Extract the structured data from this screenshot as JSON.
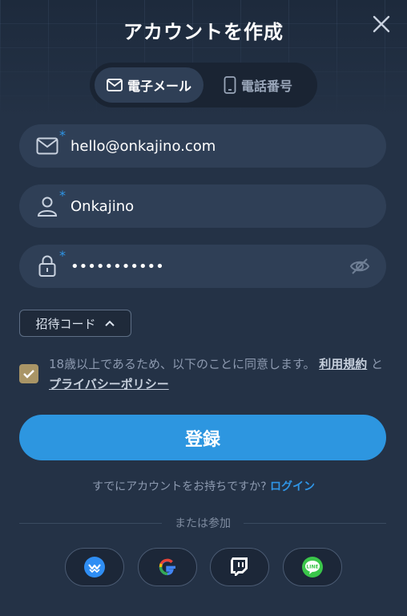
{
  "title": "アカウントを作成",
  "tabs": [
    {
      "label": "電子メール",
      "icon": "mail-icon",
      "active": true
    },
    {
      "label": "電話番号",
      "icon": "phone-icon",
      "active": false
    }
  ],
  "fields": {
    "email": {
      "value": "hello@onkajino.com",
      "required_mark": "*"
    },
    "username": {
      "value": "Onkajino",
      "required_mark": "*"
    },
    "password": {
      "value": "•••••••••••",
      "required_mark": "*"
    }
  },
  "invite": {
    "label": "招待コード"
  },
  "consent": {
    "text": "18歳以上であるため、以下のことに同意します。",
    "terms_link": "利用規約",
    "and": "と",
    "privacy_link": "プライバシーポリシー"
  },
  "register_label": "登録",
  "login": {
    "prompt": "すでにアカウントをお持ちですか?",
    "link": "ログイン"
  },
  "divider_label": "または参加",
  "socials": [
    "wallet-icon",
    "google-icon",
    "twitch-icon",
    "line-icon"
  ],
  "colors": {
    "accent": "#2d96e0",
    "background": "#243246",
    "field": "#2f3f56",
    "checkbox": "#a99566"
  }
}
